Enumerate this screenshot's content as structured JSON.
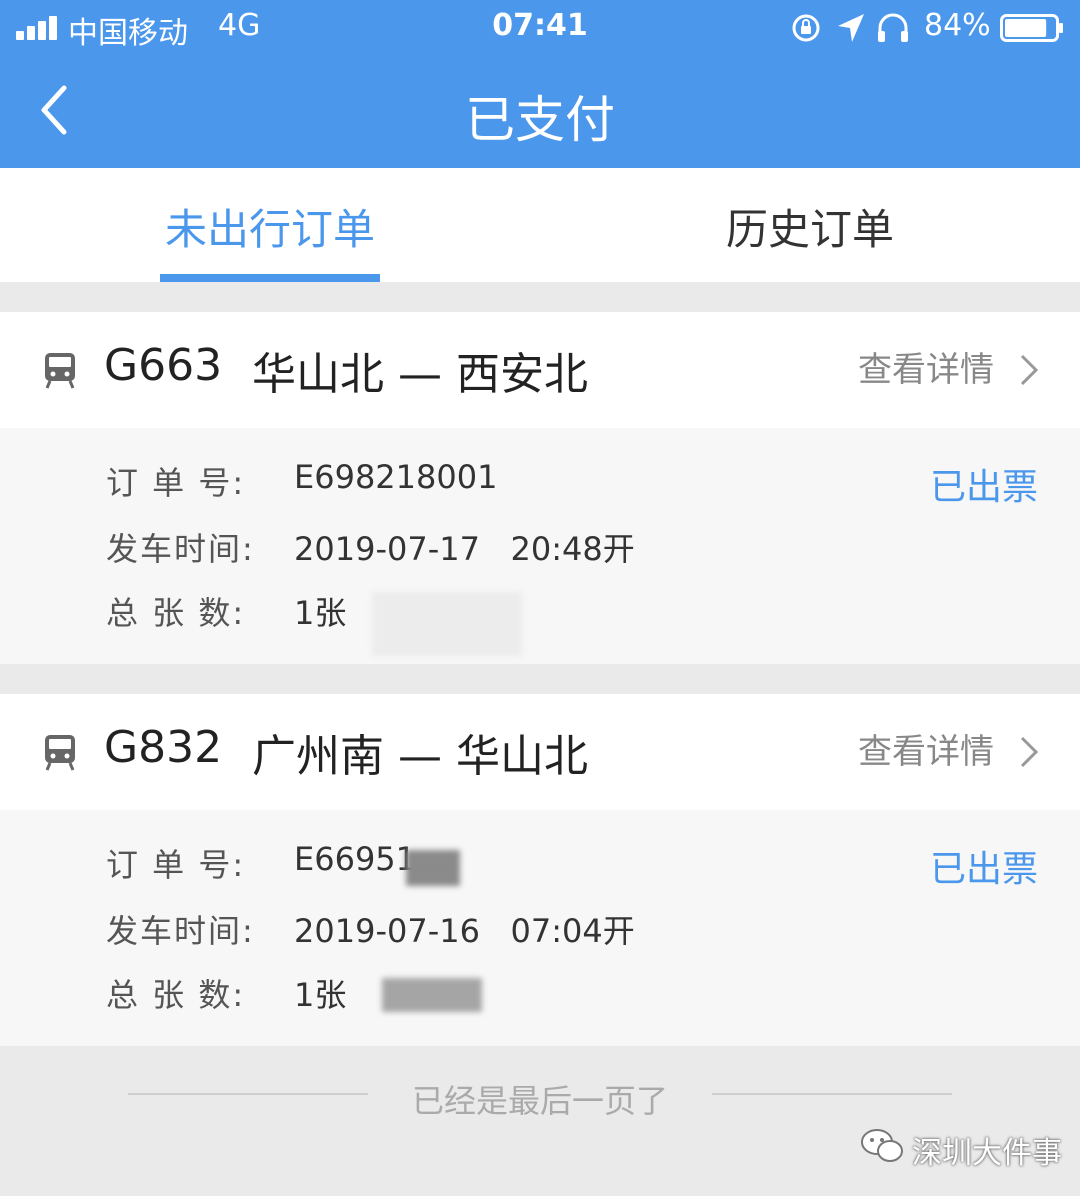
{
  "status_bar": {
    "carrier": "中国移动",
    "network": "4G",
    "time": "07:41",
    "battery": "84%",
    "battery_level": 0.84
  },
  "nav": {
    "title": "已支付"
  },
  "tabs": [
    {
      "label": "未出行订单",
      "active": true
    },
    {
      "label": "历史订单",
      "active": false
    }
  ],
  "orders": [
    {
      "train_no": "G663",
      "route": "华山北 — 西安北",
      "detail_label": "查看详情",
      "status": "已出票",
      "rows": [
        {
          "label": "订 单 号:",
          "value": "E698218001"
        },
        {
          "label": "发车时间:",
          "value": "2019-07-17   20:48开"
        },
        {
          "label": "总 张 数:",
          "value": "1张"
        }
      ]
    },
    {
      "train_no": "G832",
      "route": "广州南 — 华山北",
      "detail_label": "查看详情",
      "status": "已出票",
      "rows": [
        {
          "label": "订 单 号:",
          "value": "E66951"
        },
        {
          "label": "发车时间:",
          "value": "2019-07-16   07:04开"
        },
        {
          "label": "总 张 数:",
          "value": "1张"
        }
      ]
    }
  ],
  "footer": {
    "end_text": "已经是最后一页了"
  },
  "watermark": {
    "text": "深圳大件事"
  },
  "colors": {
    "accent": "#4a97ec",
    "text_primary": "#222222",
    "text_muted": "#888888"
  }
}
